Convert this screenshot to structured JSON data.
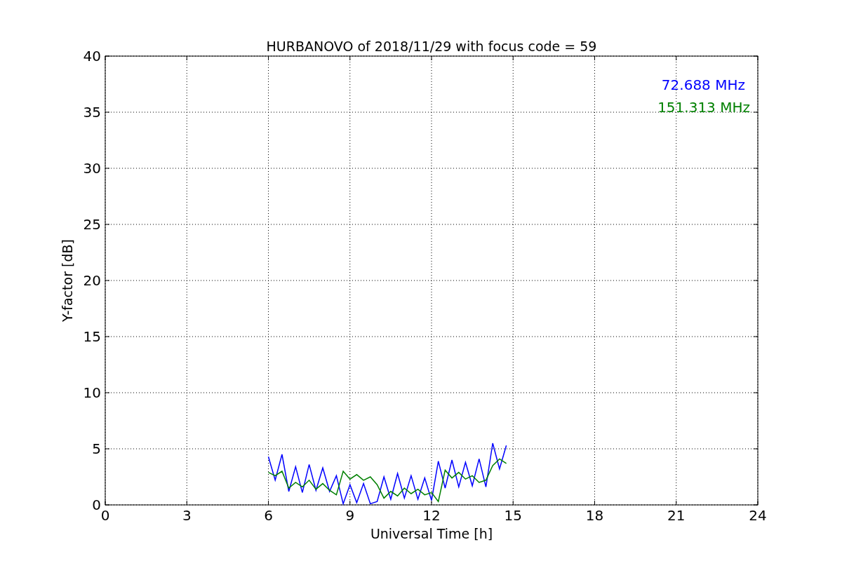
{
  "chart_data": {
    "type": "line",
    "title": "HURBANOVO of 2018/11/29 with focus code = 59",
    "xlabel": "Universal Time [h]",
    "ylabel": "Y-factor [dB]",
    "x": [
      6,
      6.25,
      6.5,
      6.75,
      7,
      7.25,
      7.5,
      7.75,
      8,
      8.25,
      8.5,
      8.75,
      9,
      9.25,
      9.5,
      9.75,
      10,
      10.25,
      10.5,
      10.75,
      11,
      11.25,
      11.5,
      11.75,
      12,
      12.25,
      12.5,
      12.75,
      13,
      13.25,
      13.5,
      13.75,
      14,
      14.25,
      14.5,
      14.75
    ],
    "series": [
      {
        "name": "72.688 MHz",
        "color": "#0000ff",
        "values": [
          4.3,
          2.2,
          4.5,
          1.2,
          3.4,
          1.1,
          3.6,
          1.3,
          3.3,
          1.2,
          2.6,
          0.1,
          1.8,
          0.2,
          1.9,
          0.1,
          0.3,
          2.5,
          0.5,
          2.8,
          0.6,
          2.6,
          0.5,
          2.4,
          0.4,
          3.9,
          1.5,
          4.0,
          1.6,
          3.8,
          1.7,
          4.1,
          1.6,
          5.5,
          3.2,
          5.3
        ]
      },
      {
        "name": "151.313 MHz",
        "color": "#008000",
        "values": [
          2.9,
          2.6,
          3.0,
          1.5,
          2.0,
          1.6,
          2.2,
          1.4,
          1.9,
          1.3,
          0.9,
          3.0,
          2.3,
          2.7,
          2.2,
          2.5,
          1.8,
          0.6,
          1.2,
          0.8,
          1.5,
          1.0,
          1.4,
          0.9,
          1.1,
          0.3,
          3.1,
          2.4,
          2.9,
          2.3,
          2.6,
          2.0,
          2.2,
          3.5,
          4.1,
          3.7
        ]
      }
    ],
    "xlim": [
      0,
      24
    ],
    "ylim": [
      0,
      40
    ],
    "xticks": [
      0,
      3,
      6,
      9,
      12,
      15,
      18,
      21,
      24
    ],
    "yticks": [
      0,
      5,
      10,
      15,
      20,
      25,
      30,
      35,
      40
    ],
    "grid": true
  }
}
